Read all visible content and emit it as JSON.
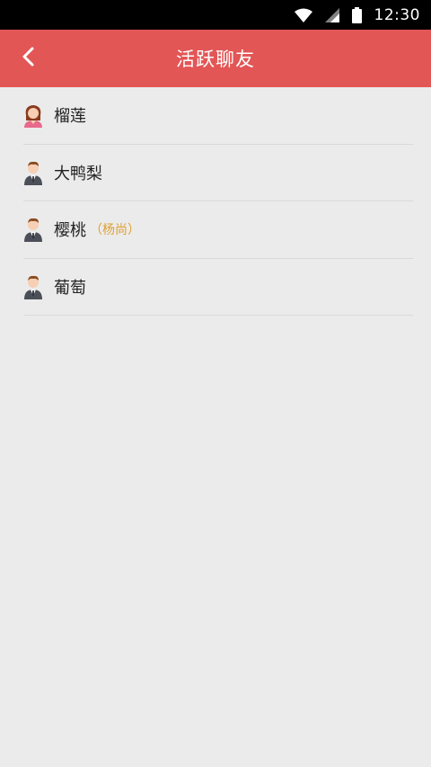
{
  "status_bar": {
    "time": "12:30",
    "icons": [
      "wifi-icon",
      "signal-icon",
      "battery-icon"
    ]
  },
  "app_bar": {
    "title": "活跃聊友",
    "back_icon": "chevron-left-icon",
    "color": "#e35656"
  },
  "friends": [
    {
      "name": "榴莲",
      "tag": "",
      "avatar": "female-avatar-icon"
    },
    {
      "name": "大鸭梨",
      "tag": "",
      "avatar": "male-avatar-icon"
    },
    {
      "name": "樱桃",
      "tag": "（杨尚）",
      "avatar": "male-avatar-icon"
    },
    {
      "name": "葡萄",
      "tag": "",
      "avatar": "male-avatar-icon"
    }
  ],
  "colors": {
    "tag": "#e0a030",
    "background": "#ebebeb",
    "divider": "#d9d9d9"
  }
}
